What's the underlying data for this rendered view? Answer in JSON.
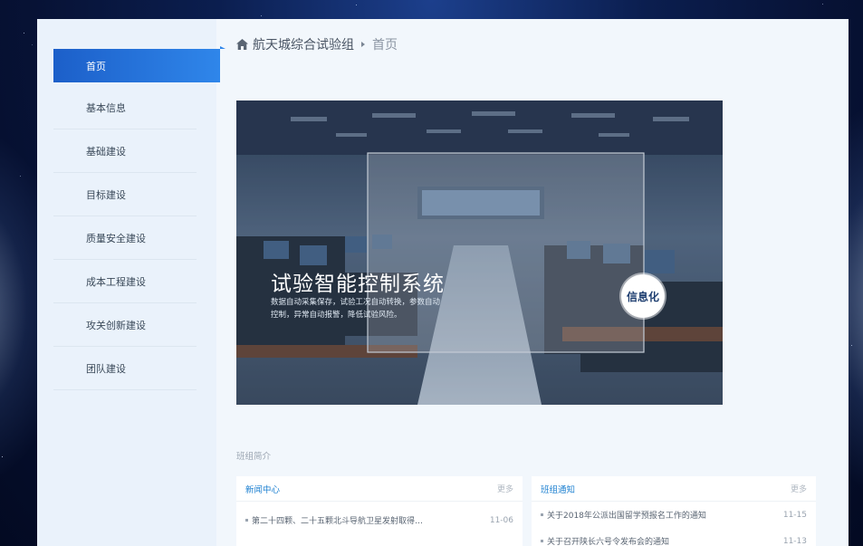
{
  "sidebar": {
    "items": [
      {
        "label": "首页",
        "active": true
      },
      {
        "label": "基本信息",
        "active": false
      },
      {
        "label": "基础建设",
        "active": false
      },
      {
        "label": "目标建设",
        "active": false
      },
      {
        "label": "质量安全建设",
        "active": false
      },
      {
        "label": "成本工程建设",
        "active": false
      },
      {
        "label": "攻关创新建设",
        "active": false
      },
      {
        "label": "团队建设",
        "active": false
      }
    ]
  },
  "breadcrumb": {
    "home_icon": "home-icon",
    "group": "航天城综合试验组",
    "current": "首页"
  },
  "banner": {
    "title": "试验智能控制系统",
    "subtitle": "数据自动采集保存，试验工况自动转换，参数自动控制，异常自动报警，降低试验风险。",
    "badge": "信息化"
  },
  "section": {
    "title": "班组简介"
  },
  "news": {
    "title": "新闻中心",
    "more": "更多",
    "items": [
      {
        "text": "第二十四颗、二十五颗北斗导航卫星发射取得…",
        "date": "11-06"
      }
    ]
  },
  "notices": {
    "title": "班组通知",
    "more": "更多",
    "items": [
      {
        "text": "关于2018年公派出国留学预报名工作的通知",
        "date": "11-15"
      },
      {
        "text": "关于召开陕长六号令发布会的通知",
        "date": "11-13"
      }
    ]
  },
  "colors": {
    "accent": "#2f86ea",
    "link": "#1b7fd0"
  }
}
